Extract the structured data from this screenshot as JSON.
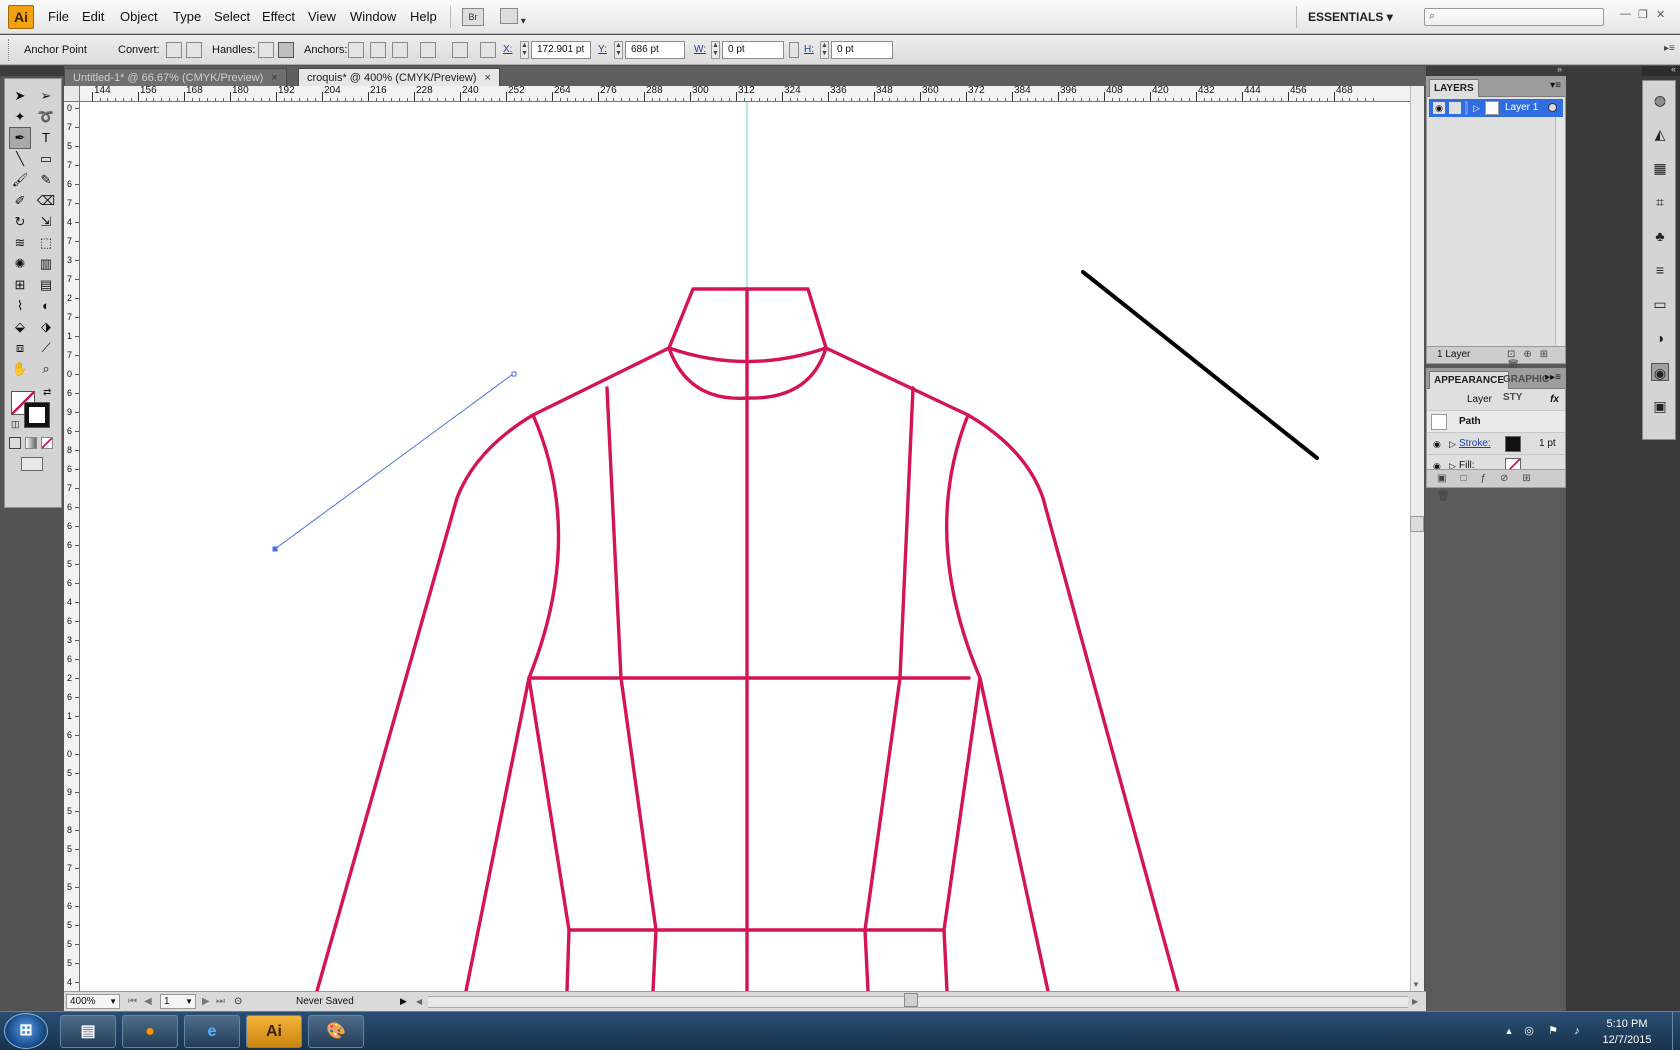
{
  "app": {
    "logo": "Ai",
    "essentials": "ESSENTIALS"
  },
  "menus": [
    "File",
    "Edit",
    "Object",
    "Type",
    "Select",
    "Effect",
    "View",
    "Window",
    "Help"
  ],
  "menubar": {
    "bridge_label": "Br"
  },
  "control": {
    "tool_label": "Anchor Point",
    "convert_label": "Convert:",
    "handles_label": "Handles:",
    "anchors_label": "Anchors:",
    "x_label": "X:",
    "x_value": "172.901 pt",
    "y_label": "Y:",
    "y_value": "686 pt",
    "w_label": "W:",
    "w_value": "0 pt",
    "h_label": "H:",
    "h_value": "0 pt"
  },
  "tabs": [
    {
      "label": "Untitled-1* @ 66.67% (CMYK/Preview)",
      "close": "×"
    },
    {
      "label": "croquis* @ 400% (CMYK/Preview)",
      "close": "×"
    }
  ],
  "ruler": {
    "h_ticks": [
      "144",
      "156",
      "168",
      "180",
      "192",
      "204",
      "216",
      "228",
      "240",
      "252",
      "264",
      "276",
      "288",
      "300",
      "312",
      "324",
      "336",
      "348",
      "360",
      "372",
      "384",
      "396",
      "408",
      "420",
      "432",
      "444",
      "456",
      "468"
    ],
    "v_ticks": [
      "0",
      "7",
      "5",
      "7",
      "6",
      "7",
      "4",
      "7",
      "3",
      "7",
      "2",
      "7",
      "1",
      "7",
      "0",
      "6",
      "9",
      "6",
      "8",
      "6",
      "7",
      "6",
      "6",
      "6",
      "5",
      "6",
      "4",
      "6",
      "3",
      "6",
      "2",
      "6",
      "1",
      "6",
      "0",
      "5",
      "9",
      "5",
      "8",
      "5",
      "7",
      "5",
      "6",
      "5",
      "5",
      "5",
      "4"
    ]
  },
  "status": {
    "zoom": "400%",
    "page": "1",
    "saved_text": "Never Saved"
  },
  "layers": {
    "tab": "LAYERS",
    "row": "Layer 1",
    "footer": "1 Layer"
  },
  "appearance": {
    "tab1": "APPEARANCE",
    "tab2": "GRAPHIC STY",
    "header": "Layer",
    "fx": "fx",
    "path": "Path",
    "stroke_label": "Stroke:",
    "stroke_weight": "1 pt",
    "fill_label": "Fill:"
  },
  "taskbar": {
    "time": "5:10 PM",
    "date": "12/7/2015",
    "ai_button": "Ai"
  },
  "colors": {
    "croquis_stroke": "#d31552",
    "guide": "#6ad6d6",
    "selected_path": "#4a6fd9",
    "layer_highlight": "#2f6de1",
    "app_orange": "#f2a114"
  },
  "icons": {
    "toolbox": [
      "selection-arrow-icon",
      "direct-selection-icon",
      "magic-wand-icon",
      "lasso-icon",
      "pen-icon",
      "type-icon",
      "line-segment-icon",
      "rectangle-icon",
      "paintbrush-icon",
      "pencil-icon",
      "blob-brush-icon",
      "eraser-icon",
      "rotate-icon",
      "scale-icon",
      "warp-icon",
      "free-transform-icon",
      "symbol-sprayer-icon",
      "column-graph-icon",
      "mesh-icon",
      "gradient-icon",
      "eyedropper-icon",
      "blend-icon",
      "live-paint-icon",
      "live-paint-select-icon",
      "artboard-icon",
      "slice-icon",
      "hand-icon",
      "zoom-icon"
    ],
    "dock": [
      "color-icon",
      "color-guide-icon",
      "swatches-icon",
      "brushes-icon",
      "symbols-icon",
      "stroke-icon",
      "gradient-icon",
      "transparency-icon",
      "appearance-icon",
      "graphic-styles-icon"
    ]
  }
}
